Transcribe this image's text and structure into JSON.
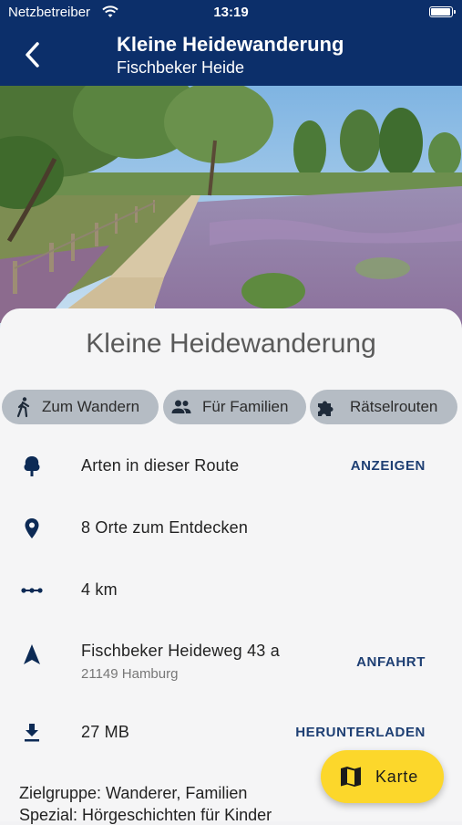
{
  "status_bar": {
    "carrier": "Netzbetreiber",
    "time": "13:19",
    "battery_level": 0.95
  },
  "nav": {
    "title": "Kleine Heidewanderung",
    "subtitle": "Fischbeker Heide",
    "back_icon": "chevron-left-icon"
  },
  "route": {
    "title": "Kleine Heidewanderung",
    "chips": [
      {
        "label": "Zum Wandern",
        "icon": "hiker-icon"
      },
      {
        "label": "Für Familien",
        "icon": "people-icon"
      },
      {
        "label": "Rätselrouten",
        "icon": "puzzle-icon"
      }
    ],
    "rows": {
      "species": {
        "text": "Arten in dieser Route",
        "action": "ANZEIGEN",
        "icon": "tree-icon"
      },
      "places": {
        "text": "8 Orte zum Entdecken",
        "icon": "location-pin-icon"
      },
      "distance": {
        "text": "4 km",
        "icon": "route-dots-icon"
      },
      "address": {
        "text": "Fischbeker Heideweg 43 a",
        "subtext": "21149 Hamburg",
        "action": "ANFAHRT",
        "icon": "navigation-arrow-icon"
      },
      "download": {
        "text": "27 MB",
        "action": "HERUNTERLADEN",
        "icon": "download-icon"
      }
    },
    "target_group": "Zielgruppe: Wanderer, Familien",
    "special": "Spezial: Hörgeschichten für Kinder"
  },
  "fab": {
    "label": "Karte",
    "icon": "map-icon"
  },
  "colors": {
    "header": "#0c2f6a",
    "chip": "#b5bcc4",
    "action": "#1e3f73",
    "fab": "#fcd72b"
  }
}
